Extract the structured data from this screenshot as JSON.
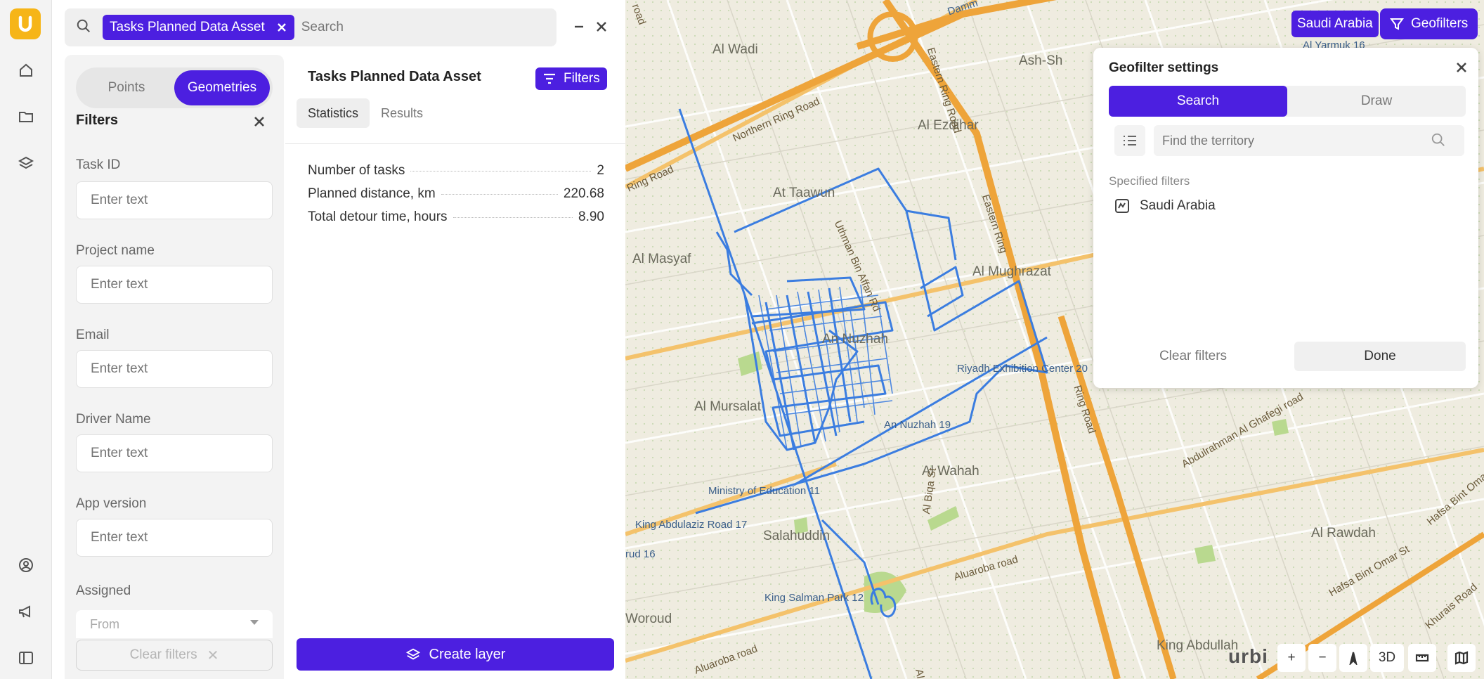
{
  "rail": {
    "logo_letter": "U",
    "items": [
      {
        "name": "home-icon"
      },
      {
        "name": "folder-icon"
      },
      {
        "name": "layers-icon"
      },
      {
        "name": "profile-icon"
      },
      {
        "name": "megaphone-icon"
      },
      {
        "name": "sidebar-toggle-icon"
      }
    ]
  },
  "search": {
    "chip_label": "Tasks Planned Data Asset",
    "placeholder": "Search"
  },
  "filters": {
    "mode_tabs": [
      "Points",
      "Geometries"
    ],
    "active_mode": "Geometries",
    "heading": "Filters",
    "fields": [
      {
        "label": "Task ID",
        "placeholder": "Enter text"
      },
      {
        "label": "Project name",
        "placeholder": "Enter text"
      },
      {
        "label": "Email",
        "placeholder": "Enter text"
      },
      {
        "label": "Driver Name",
        "placeholder": "Enter text"
      },
      {
        "label": "App version",
        "placeholder": "Enter text"
      }
    ],
    "assigned_label": "Assigned",
    "assigned_placeholder": "From",
    "clear_label": "Clear filters"
  },
  "results": {
    "title": "Tasks Planned Data Asset",
    "filters_button": "Filters",
    "tabs": [
      "Statistics",
      "Results"
    ],
    "active_tab": "Statistics",
    "stats": [
      {
        "label": "Number of tasks",
        "value": "2"
      },
      {
        "label": "Planned distance, km",
        "value": "220.68"
      },
      {
        "label": "Total detour time, hours",
        "value": "8.90"
      }
    ],
    "create_button": "Create layer"
  },
  "map": {
    "country_chip": "Saudi Arabia",
    "geofilters_button": "Geofilters",
    "brand": "urbi",
    "controls": {
      "zoom_in": "+",
      "zoom_out": "−",
      "compass": "compass-icon",
      "mode_3d": "3D",
      "ruler": "ruler-icon",
      "layers": "map-icon"
    },
    "labels": {
      "al_wadi": "Al Wadi",
      "al_ezdihar": "Al Ezdihar",
      "at_taawun": "At Taawun",
      "al_masyaf": "Al Masyaf",
      "al_mughrazat": "Al Mughrazat",
      "an_nuzhah": "An Nuzhah",
      "al_mursalat": "Al Mursalat",
      "al_wahah": "Al Wahah",
      "salahuddin": "Salahuddin",
      "woroud": "Woroud",
      "al_rawdah": "Al Rawdah",
      "king_abdullah": "King Abdullah",
      "ash_sh": "Ash-Sh",
      "damm": "Damm",
      "al_yarmuk": "Al Yarmuk 16",
      "northern_ring": "Northern Ring Road",
      "ring_road": "Ring Road",
      "eastern_ring": "Eastern Ring Road",
      "eastern_ring2": "Eastern Ring",
      "ring_road_right": "Ring Road",
      "riyadh_exhibition": "Riyadh Exhibition Center 20",
      "an_nuzhah_19": "An Nuzhah 19",
      "ministry_edu": "Ministry of Education 11",
      "king_abdulaziz": "King Abdulaziz Road 17",
      "urud": "rud 16",
      "king_salman": "King Salman Park 12",
      "aluaroba": "Aluaroba road",
      "aluaroba2": "Aluaroba road",
      "al_biqa": "Al Biqa St",
      "abdulrahman": "Abdulrahman Al Ghafegi road",
      "hafsa": "Hafsa Bint Omar St",
      "hafsa2": "Hafsa Bint Omar",
      "khurais": "Khurais Road",
      "uthman": "Uthman Bin Affan Rd",
      "road": "road",
      "al": "Al"
    }
  },
  "geofilter": {
    "title": "Geofilter settings",
    "tabs": [
      "Search",
      "Draw"
    ],
    "active_tab": "Search",
    "input_placeholder": "Find the territory",
    "specified_label": "Specified filters",
    "items": [
      "Saudi Arabia"
    ],
    "clear_label": "Clear filters",
    "done_label": "Done"
  },
  "colors": {
    "accent": "#4c1fe0",
    "logo": "#f6b518",
    "route": "#3b7de0",
    "highway": "#f0a030"
  }
}
